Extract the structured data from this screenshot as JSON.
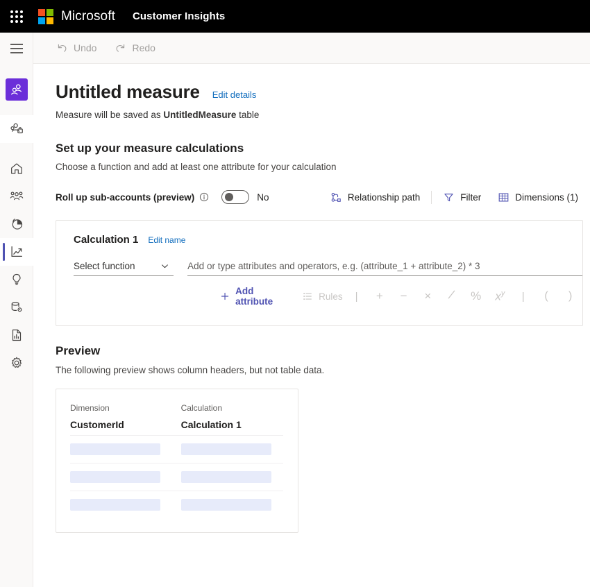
{
  "suitebar": {
    "waffle_label": "app-launcher",
    "brand": "Microsoft",
    "app_name": "Customer Insights"
  },
  "commandbar": {
    "undo_label": "Undo",
    "redo_label": "Redo"
  },
  "sidebar": {
    "items": [
      {
        "icon": "audience-insights-avatar-icon",
        "label": "Audience insights",
        "active": false,
        "kind": "avatar"
      },
      {
        "icon": "environment-people-icon",
        "label": "Environment",
        "active": false,
        "kind": "env"
      },
      {
        "icon": "home-icon",
        "label": "Home",
        "active": false,
        "kind": "nav"
      },
      {
        "icon": "customers-icon",
        "label": "Customers",
        "active": false,
        "kind": "nav"
      },
      {
        "icon": "segments-pie-icon",
        "label": "Segments",
        "active": false,
        "kind": "nav"
      },
      {
        "icon": "measures-chart-icon",
        "label": "Measures",
        "active": true,
        "kind": "nav"
      },
      {
        "icon": "lightbulb-icon",
        "label": "Intelligence",
        "active": false,
        "kind": "nav"
      },
      {
        "icon": "data-settings-icon",
        "label": "Data",
        "active": false,
        "kind": "nav"
      },
      {
        "icon": "report-document-icon",
        "label": "Reports",
        "active": false,
        "kind": "nav"
      },
      {
        "icon": "gear-icon",
        "label": "Admin settings",
        "active": false,
        "kind": "nav"
      }
    ]
  },
  "page": {
    "title": "Untitled measure",
    "edit_details_label": "Edit details",
    "subtitle_prefix": "Measure will be saved as ",
    "subtitle_table": "UntitledMeasure",
    "subtitle_suffix": " table",
    "section_heading": "Set up your measure calculations",
    "section_sub": "Choose a function and add at least one attribute for your calculation"
  },
  "options": {
    "rollup_label": "Roll up sub-accounts (preview)",
    "info_icon": "info-icon",
    "toggle_state": "No",
    "relationship_path_label": "Relationship path",
    "filter_label": "Filter",
    "dimensions_label": "Dimensions (1)"
  },
  "calculation": {
    "title": "Calculation 1",
    "edit_name_label": "Edit name",
    "function_placeholder": "Select function",
    "formula_placeholder": "Add or type attributes and operators, e.g. (attribute_1 + attribute_2) * 3",
    "formula_value": "",
    "add_attribute_label": "Add attribute",
    "rules_label": "Rules",
    "operators": [
      "+",
      "−",
      "×",
      "/",
      "%",
      "xʸ",
      "(",
      ")"
    ]
  },
  "preview": {
    "heading": "Preview",
    "sub": "The following preview shows column headers, but not table data.",
    "columns": [
      {
        "group": "Dimension",
        "name": "CustomerId"
      },
      {
        "group": "Calculation",
        "name": "Calculation 1"
      }
    ],
    "placeholder_rows": 3
  },
  "colors": {
    "accent_purple": "#6B2FD9",
    "accent_blue": "#4F52B2",
    "link_blue": "#0f6cbd",
    "skeleton": "#e7ebfa",
    "topbar": "#000000"
  }
}
